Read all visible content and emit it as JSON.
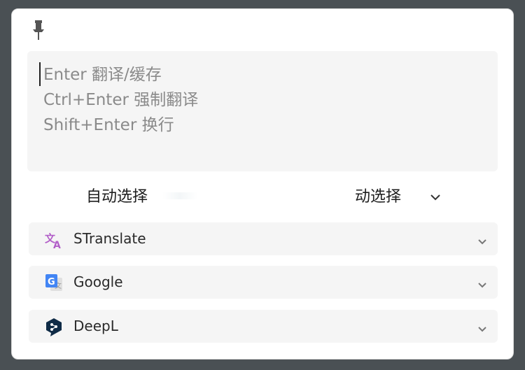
{
  "input": {
    "placeholder_lines": [
      "Enter 翻译/缓存",
      "Ctrl+Enter 强制翻译",
      "Shift+Enter 换行"
    ]
  },
  "language": {
    "source": "自动选择",
    "target": "动选择"
  },
  "services": [
    {
      "name": "STranslate",
      "icon": "stranslate-icon",
      "color": "#b25fc8"
    },
    {
      "name": "Google",
      "icon": "google-translate-icon",
      "color": "#4285f4"
    },
    {
      "name": "DeepL",
      "icon": "deepl-icon",
      "color": "#0f2b46"
    }
  ]
}
